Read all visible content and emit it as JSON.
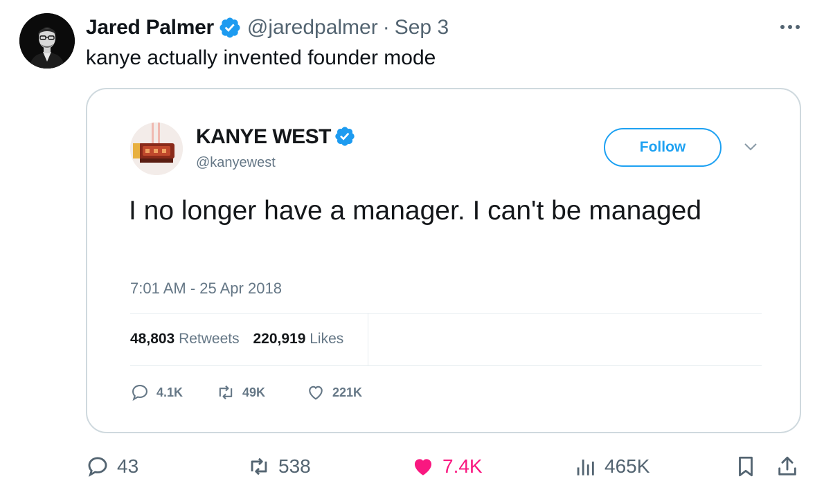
{
  "post": {
    "author_name": "Jared Palmer",
    "author_handle": "@jaredpalmer",
    "separator": "·",
    "date": "Sep 3",
    "text": "kanye actually invented founder mode"
  },
  "quoted_tweet": {
    "author_name": "KANYE WEST",
    "author_handle": "@kanyewest",
    "follow_label": "Follow",
    "text": "I no longer have a manager. I can't be managed",
    "timestamp": "7:01 AM - 25 Apr 2018",
    "retweets_count": "48,803",
    "retweets_label": "Retweets",
    "likes_count": "220,919",
    "likes_label": "Likes",
    "actions": {
      "replies": "4.1K",
      "retweets": "49K",
      "likes": "221K"
    }
  },
  "actions": {
    "replies": "43",
    "reposts": "538",
    "likes": "7.4K",
    "views": "465K"
  },
  "colors": {
    "verified_blue": "#1d9bf0",
    "like_pink": "#f91880",
    "follow_blue": "#1da1f2"
  }
}
